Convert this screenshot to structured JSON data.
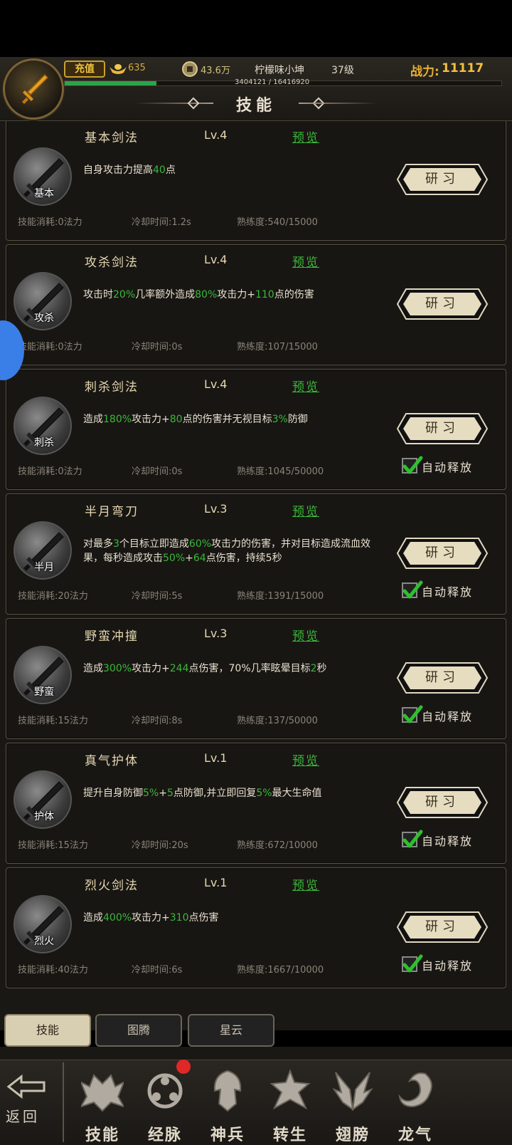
{
  "header": {
    "recharge_label": "充值",
    "ingot_value": "635",
    "coin_value": "43.6万",
    "player_name": "柠檬味小坤",
    "player_level": "37级",
    "power_label": "战力:",
    "power_value": "11117",
    "exp_text": "3404121 / 16416920",
    "exp_fraction": 0.21
  },
  "page_title": "技能",
  "skills": [
    {
      "name": "基本剑法",
      "level": "Lv.4",
      "preview": "预览",
      "icon_label": "基本",
      "desc": [
        [
          "自身攻击力提高",
          ""
        ],
        [
          "40",
          "g"
        ],
        [
          "点",
          ""
        ]
      ],
      "cost": "技能消耗:0法力",
      "cooldown": "冷却时间:1.2s",
      "mastery": "熟练度:540/15000",
      "study": "研习",
      "auto": null
    },
    {
      "name": "攻杀剑法",
      "level": "Lv.4",
      "preview": "预览",
      "icon_label": "攻杀",
      "desc": [
        [
          "攻击时",
          ""
        ],
        [
          "20%",
          "g"
        ],
        [
          "几率额外造成",
          ""
        ],
        [
          "80%",
          "g"
        ],
        [
          "攻击力+",
          ""
        ],
        [
          "110",
          "g"
        ],
        [
          "点的伤害",
          ""
        ]
      ],
      "cost": "技能消耗:0法力",
      "cooldown": "冷却时间:0s",
      "mastery": "熟练度:107/15000",
      "study": "研习",
      "auto": null
    },
    {
      "name": "刺杀剑法",
      "level": "Lv.4",
      "preview": "预览",
      "icon_label": "刺杀",
      "desc": [
        [
          "造成",
          ""
        ],
        [
          "180%",
          "g"
        ],
        [
          "攻击力+",
          ""
        ],
        [
          "80",
          "g"
        ],
        [
          "点的伤害并无视目标",
          ""
        ],
        [
          "3%",
          "g"
        ],
        [
          "防御",
          ""
        ]
      ],
      "cost": "技能消耗:0法力",
      "cooldown": "冷却时间:0s",
      "mastery": "熟练度:1045/50000",
      "study": "研习",
      "auto": "自动释放"
    },
    {
      "name": "半月弯刀",
      "level": "Lv.3",
      "preview": "预览",
      "icon_label": "半月",
      "desc": [
        [
          "对最多",
          ""
        ],
        [
          "3",
          "g"
        ],
        [
          "个目标立即造成",
          ""
        ],
        [
          "60%",
          "g"
        ],
        [
          "攻击力的伤害，并对目标造成流血效果，每秒造成攻击",
          ""
        ],
        [
          "50%",
          "g"
        ],
        [
          "+",
          ""
        ],
        [
          "64",
          "g"
        ],
        [
          "点伤害，持续5秒",
          ""
        ]
      ],
      "cost": "技能消耗:20法力",
      "cooldown": "冷却时间:5s",
      "mastery": "熟练度:1391/15000",
      "study": "研习",
      "auto": "自动释放"
    },
    {
      "name": "野蛮冲撞",
      "level": "Lv.3",
      "preview": "预览",
      "icon_label": "野蛮",
      "desc": [
        [
          "造成",
          ""
        ],
        [
          "300%",
          "g"
        ],
        [
          "攻击力+",
          ""
        ],
        [
          "244",
          "g"
        ],
        [
          "点伤害，70%几率眩晕目标",
          ""
        ],
        [
          "2",
          "g"
        ],
        [
          "秒",
          ""
        ]
      ],
      "cost": "技能消耗:15法力",
      "cooldown": "冷却时间:8s",
      "mastery": "熟练度:137/50000",
      "study": "研习",
      "auto": "自动释放"
    },
    {
      "name": "真气护体",
      "level": "Lv.1",
      "preview": "预览",
      "icon_label": "护体",
      "desc": [
        [
          "提升自身防御",
          ""
        ],
        [
          "5%",
          "g"
        ],
        [
          "+",
          ""
        ],
        [
          "5",
          "g"
        ],
        [
          "点防御,并立即回复",
          ""
        ],
        [
          "5%",
          "g"
        ],
        [
          "最大生命值",
          ""
        ]
      ],
      "cost": "技能消耗:15法力",
      "cooldown": "冷却时间:20s",
      "mastery": "熟练度:672/10000",
      "study": "研习",
      "auto": "自动释放"
    },
    {
      "name": "烈火剑法",
      "level": "Lv.1",
      "preview": "预览",
      "icon_label": "烈火",
      "desc": [
        [
          "造成",
          ""
        ],
        [
          "400%",
          "g"
        ],
        [
          "攻击力+",
          ""
        ],
        [
          "310",
          "g"
        ],
        [
          "点伤害",
          ""
        ]
      ],
      "cost": "技能消耗:40法力",
      "cooldown": "冷却时间:6s",
      "mastery": "熟练度:1667/10000",
      "study": "研习",
      "auto": "自动释放"
    }
  ],
  "sub_tabs": [
    {
      "label": "技能",
      "active": true
    },
    {
      "label": "图腾",
      "active": false
    },
    {
      "label": "星云",
      "active": false
    }
  ],
  "nav": {
    "back_label": "返回",
    "items": [
      {
        "label": "技能",
        "icon": "skill-icon"
      },
      {
        "label": "经脉",
        "icon": "meridian-icon",
        "badge": true
      },
      {
        "label": "神兵",
        "icon": "divine-weapon-icon"
      },
      {
        "label": "转生",
        "icon": "rebirth-icon"
      },
      {
        "label": "翅膀",
        "icon": "wings-icon"
      },
      {
        "label": "龙气",
        "icon": "dragon-icon"
      }
    ]
  },
  "colors": {
    "highlight_green": "#3ab83a",
    "gold": "#f0c040",
    "badge_red": "#e02828"
  }
}
